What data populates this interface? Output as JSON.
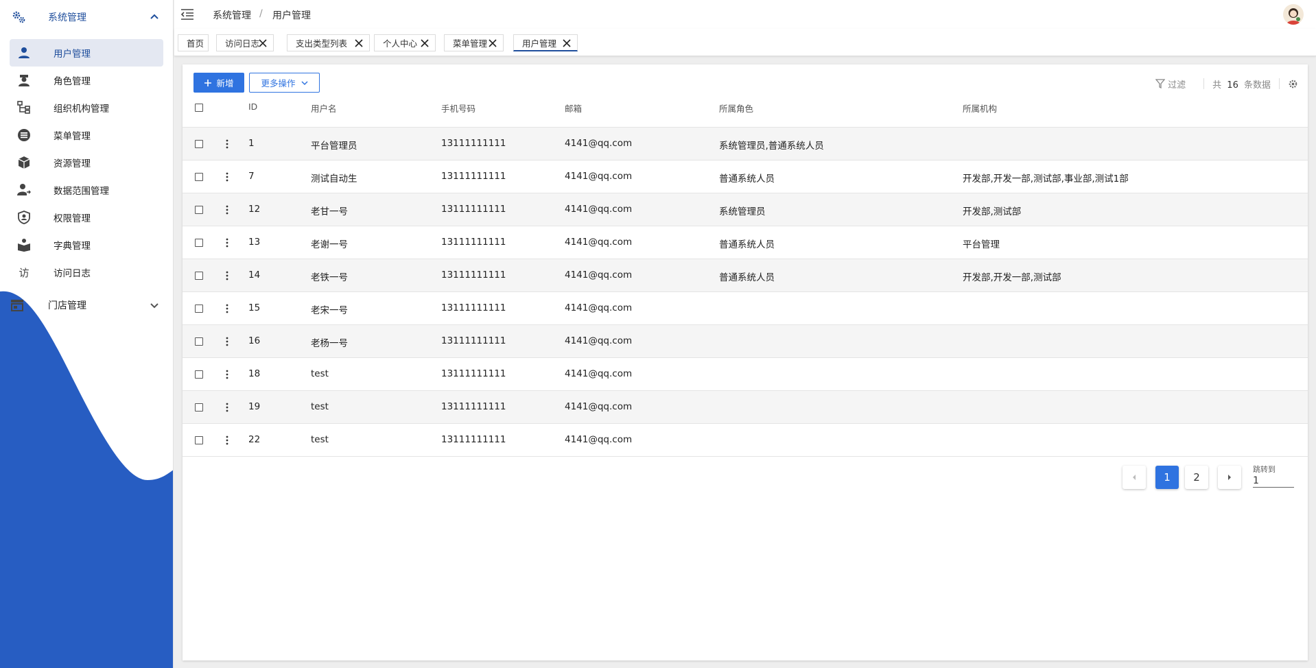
{
  "sidebar": {
    "group": {
      "label": "系统管理"
    },
    "items": [
      {
        "label": "用户管理",
        "icon": "user-icon",
        "active": true
      },
      {
        "label": "角色管理",
        "icon": "role-icon"
      },
      {
        "label": "组织机构管理",
        "icon": "org-tree-icon"
      },
      {
        "label": "菜单管理",
        "icon": "menu-list-icon"
      },
      {
        "label": "资源管理",
        "icon": "box-icon"
      },
      {
        "label": "数据范围管理",
        "icon": "user-scope-icon"
      },
      {
        "label": "权限管理",
        "icon": "shield-icon"
      },
      {
        "label": "字典管理",
        "icon": "book-icon"
      },
      {
        "label": "访问日志",
        "icon": "visit-text-icon",
        "glyph": "访"
      }
    ],
    "group2": {
      "label": "门店管理"
    }
  },
  "header": {
    "breadcrumb": [
      "系统管理",
      "用户管理"
    ],
    "separator": "/"
  },
  "tabs": [
    {
      "label": "首页",
      "closable": false
    },
    {
      "label": "访问日志",
      "closable": true
    },
    {
      "label": "支出类型列表",
      "closable": true
    },
    {
      "label": "个人中心",
      "closable": true
    },
    {
      "label": "菜单管理",
      "closable": true
    },
    {
      "label": "用户管理",
      "closable": true,
      "active": true
    }
  ],
  "toolbar": {
    "add_label": "新增",
    "more_label": "更多操作",
    "filter_label": "过滤",
    "count_prefix": "共",
    "count_value": "16",
    "count_suffix": "条数据"
  },
  "table": {
    "columns": [
      "ID",
      "用户名",
      "手机号码",
      "邮箱",
      "所属角色",
      "所属机构"
    ],
    "rows": [
      [
        "1",
        "平台管理员",
        "13111111111",
        "4141@qq.com",
        "系统管理员,普通系统人员",
        ""
      ],
      [
        "7",
        "测试自动生",
        "13111111111",
        "4141@qq.com",
        "普通系统人员",
        "开发部,开发一部,测试部,事业部,测试1部"
      ],
      [
        "12",
        "老甘一号",
        "13111111111",
        "4141@qq.com",
        "系统管理员",
        "开发部,测试部"
      ],
      [
        "13",
        "老谢一号",
        "13111111111",
        "4141@qq.com",
        "普通系统人员",
        "平台管理"
      ],
      [
        "14",
        "老铁一号",
        "13111111111",
        "4141@qq.com",
        "普通系统人员",
        "开发部,开发一部,测试部"
      ],
      [
        "15",
        "老宋一号",
        "13111111111",
        "4141@qq.com",
        "",
        ""
      ],
      [
        "16",
        "老杨一号",
        "13111111111",
        "4141@qq.com",
        "",
        ""
      ],
      [
        "18",
        "test",
        "13111111111",
        "4141@qq.com",
        "",
        ""
      ],
      [
        "19",
        "test",
        "13111111111",
        "4141@qq.com",
        "",
        ""
      ],
      [
        "22",
        "test",
        "13111111111",
        "4141@qq.com",
        "",
        ""
      ]
    ]
  },
  "pagination": {
    "pages": [
      "1",
      "2"
    ],
    "current": "1",
    "jump_label": "跳转到",
    "jump_value": "1"
  },
  "colors": {
    "primary": "#2f73e0",
    "sidebar_wave": "#275dc2",
    "accent_text": "#1f4e9c"
  }
}
